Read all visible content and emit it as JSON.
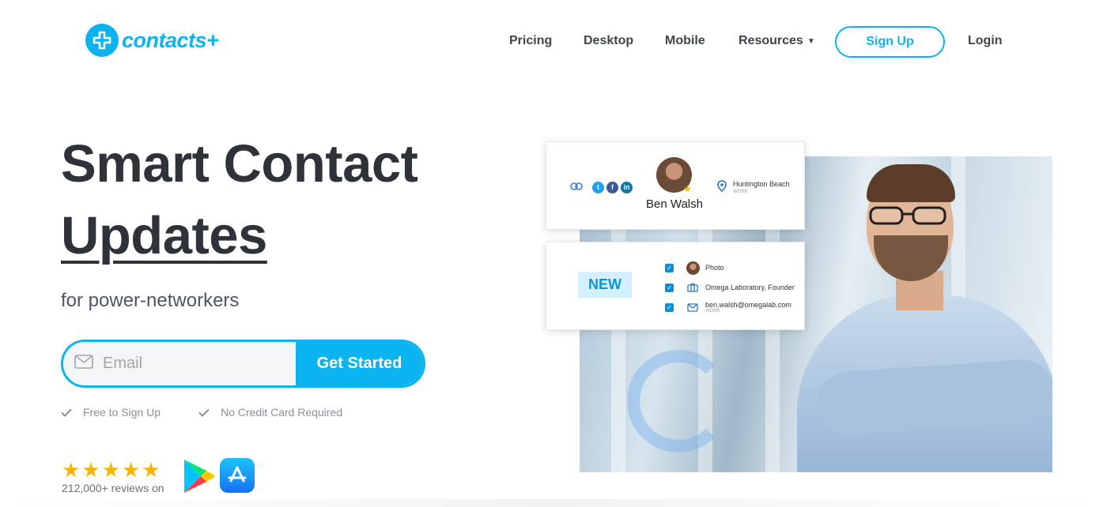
{
  "brand": {
    "name": "contacts+",
    "color": "#0bb4f0"
  },
  "nav": {
    "items": [
      "Pricing",
      "Desktop",
      "Mobile",
      "Resources"
    ],
    "signup": "Sign Up",
    "login": "Login"
  },
  "hero": {
    "title_line1": "Smart Contact",
    "title_line2": "Updates",
    "subtitle": "for power-networkers",
    "email_placeholder": "Email",
    "email_value": "",
    "cta": "Get Started",
    "perks": [
      "Free to Sign Up",
      "No Credit Card Required"
    ],
    "rating_stars": 5,
    "reviews_text": "212,000+ reviews on"
  },
  "contact_card": {
    "name": "Ben Walsh",
    "location": "Huntington Beach",
    "location_label": "WORK"
  },
  "update_card": {
    "badge": "NEW",
    "rows": [
      {
        "icon": "avatar",
        "label": "Photo",
        "sub": ""
      },
      {
        "icon": "briefcase-icon",
        "label": "Omega Laboratory, Founder",
        "sub": ""
      },
      {
        "icon": "mail-icon",
        "label": "ben.walsh@omegalab.com",
        "sub": "WORK"
      }
    ]
  }
}
